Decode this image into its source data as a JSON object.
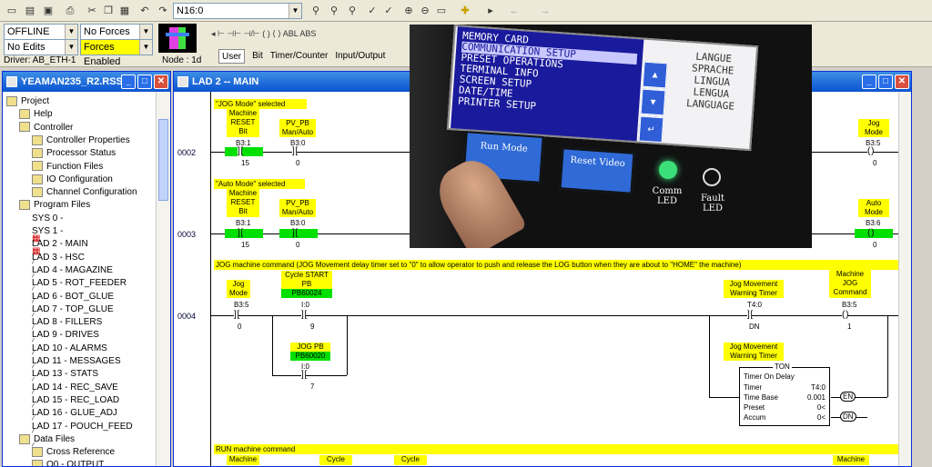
{
  "toolbar": {
    "address_value": "N16:0"
  },
  "status": {
    "mode": "OFFLINE",
    "forces": "No Forces",
    "edits": "No Edits",
    "forces_enabled": "Forces Enabled",
    "driver": "Driver: AB_ETH-1",
    "node": "Node : 1d"
  },
  "instr_tabs": [
    "User",
    "Bit",
    "Timer/Counter",
    "Input/Output"
  ],
  "project_window": {
    "title": "YEAMAN235_R2.RSS"
  },
  "tree": [
    {
      "label": "Project",
      "level": 0
    },
    {
      "label": "Help",
      "level": 1
    },
    {
      "label": "Controller",
      "level": 1
    },
    {
      "label": "Controller Properties",
      "level": 2
    },
    {
      "label": "Processor Status",
      "level": 2
    },
    {
      "label": "Function Files",
      "level": 2
    },
    {
      "label": "IO Configuration",
      "level": 2
    },
    {
      "label": "Channel Configuration",
      "level": 2
    },
    {
      "label": "Program Files",
      "level": 1
    },
    {
      "label": "SYS 0 -",
      "level": 2
    },
    {
      "label": "SYS 1 -",
      "level": 2
    },
    {
      "label": "LAD 2 - MAIN",
      "level": 2
    },
    {
      "label": "LAD 3 - HSC",
      "level": 2
    },
    {
      "label": "LAD 4 - MAGAZINE",
      "level": 2
    },
    {
      "label": "LAD 5 - ROT_FEEDER",
      "level": 2
    },
    {
      "label": "LAD 6 - BOT_GLUE",
      "level": 2
    },
    {
      "label": "LAD 7 - TOP_GLUE",
      "level": 2
    },
    {
      "label": "LAD 8 - FILLERS",
      "level": 2
    },
    {
      "label": "LAD 9 - DRIVES",
      "level": 2
    },
    {
      "label": "LAD 10 - ALARMS",
      "level": 2
    },
    {
      "label": "LAD 11 - MESSAGES",
      "level": 2
    },
    {
      "label": "LAD 13 - STATS",
      "level": 2
    },
    {
      "label": "LAD 14 - REC_SAVE",
      "level": 2
    },
    {
      "label": "LAD 15 - REC_LOAD",
      "level": 2
    },
    {
      "label": "LAD 16 - GLUE_ADJ",
      "level": 2
    },
    {
      "label": "LAD 17 - POUCH_FEED",
      "level": 2
    },
    {
      "label": "Data Files",
      "level": 1
    },
    {
      "label": "Cross Reference",
      "level": 2
    },
    {
      "label": "O0 - OUTPUT",
      "level": 2
    }
  ],
  "ladder_window": {
    "title": "LAD 2 -- MAIN"
  },
  "rungs": {
    "r2": {
      "num": "0002",
      "comment": "\"JOG Mode\" selected",
      "c1": "Machine RESET Bit",
      "c1a": "B3:1",
      "c1v": "15",
      "c2": "PV_PB Man/Auto",
      "c2a": "B3:0",
      "c2v": "0",
      "o": "Jog Mode",
      "oa": "B3:5",
      "ov": "0"
    },
    "r3": {
      "num": "0003",
      "comment": "\"Auto Mode\" selected",
      "c1": "Machine RESET Bit",
      "c1a": "B3:1",
      "c1v": "15",
      "c2": "PV_PB Man/Auto",
      "c2a": "B3:0",
      "c2v": "0",
      "o": "Auto Mode",
      "oa": "B3:6",
      "ov": "0"
    },
    "r4": {
      "num": "0004",
      "comment": "JOG machine command (JOG Movement delay timer set to \"0\" to allow operator to push and release the LOG button when they are about to \"HOME\" the machine)",
      "c1": "Jog Mode",
      "c1a": "B3:5",
      "c1v": "0",
      "c2": "Cycle START PB",
      "c2g": "PB60024",
      "c2a": "I:0",
      "c2v": "9",
      "c3": "JOG PB",
      "c3g": "PB60020",
      "c3a": "I:0",
      "c3v": "7",
      "c4": "Jog Movement Warning Timer",
      "c4a": "T4:0",
      "c4v": "DN",
      "o": "Machine JOG Command",
      "oa": "B3:5",
      "ov": "1",
      "t": "Jog Movement Warning Timer",
      "ton": "TON",
      "tod": "Timer On Delay",
      "timer_l": "Timer",
      "timer_v": "T4:0",
      "tb_l": "Time Base",
      "tb_v": "0.001",
      "pre_l": "Preset",
      "pre_v": "0<",
      "acc_l": "Accum",
      "acc_v": "0<",
      "en": "EN",
      "dn": "DN"
    },
    "r5": {
      "comment": "RUN machine command",
      "c1": "Machine",
      "c2": "Cycle",
      "c3": "Cycle",
      "o": "Machine"
    }
  },
  "hmi": {
    "menu": [
      "MEMORY CARD",
      "COMMUNICATION SETUP",
      "PRESET OPERATIONS",
      "TERMINAL INFO",
      "SCREEN SETUP",
      "DATE/TIME",
      "PRINTER SETUP"
    ],
    "langs": [
      "LANGUE",
      "SPRACHE",
      "LINGUA",
      "LENGUA",
      "LANGUAGE"
    ],
    "btn1": "Run Mode",
    "btn2": "Reset Video",
    "led1": "Comm LED",
    "led2": "Fault LED"
  }
}
